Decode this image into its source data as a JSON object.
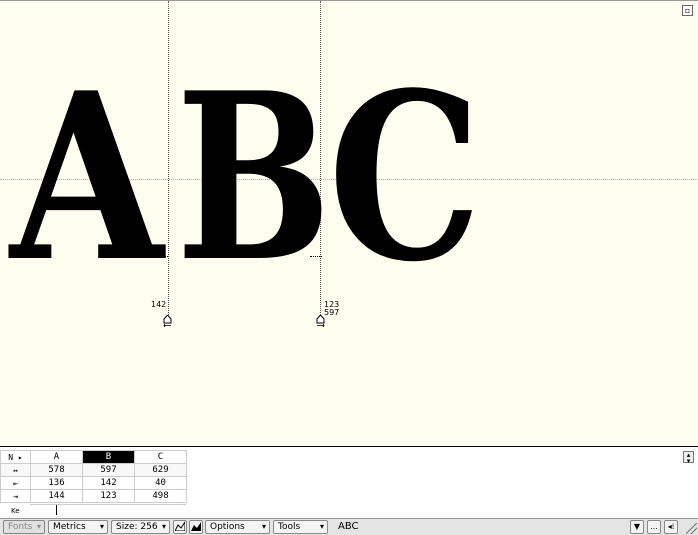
{
  "canvas": {
    "glyphs": [
      "A",
      "B",
      "C"
    ],
    "left_bearing_readout": "142",
    "right_bearing_readout_top": "123",
    "right_bearing_readout_bottom": "597",
    "corner_button_icon": "square-icon"
  },
  "metrics_table": {
    "header_icon": "N ▸",
    "columns": [
      "A",
      "B",
      "C"
    ],
    "selected_column": "B",
    "rows": [
      {
        "icon": "↔",
        "values": [
          "578",
          "597",
          "629"
        ]
      },
      {
        "icon": "⇤",
        "values": [
          "136",
          "142",
          "40"
        ]
      },
      {
        "icon": "⇥",
        "values": [
          "144",
          "123",
          "498"
        ]
      }
    ],
    "kerning_label": "Ke"
  },
  "toolbar": {
    "fonts_label": "Fonts",
    "metrics_label": "Metrics",
    "size_label": "Size: 256",
    "options_label": "Options",
    "tools_label": "Tools",
    "text_value": "ABC",
    "more_label": "..."
  },
  "colors": {
    "canvas_bg": "#fefef0",
    "guide": "#c8a0a0",
    "selected_header": "#000000"
  }
}
